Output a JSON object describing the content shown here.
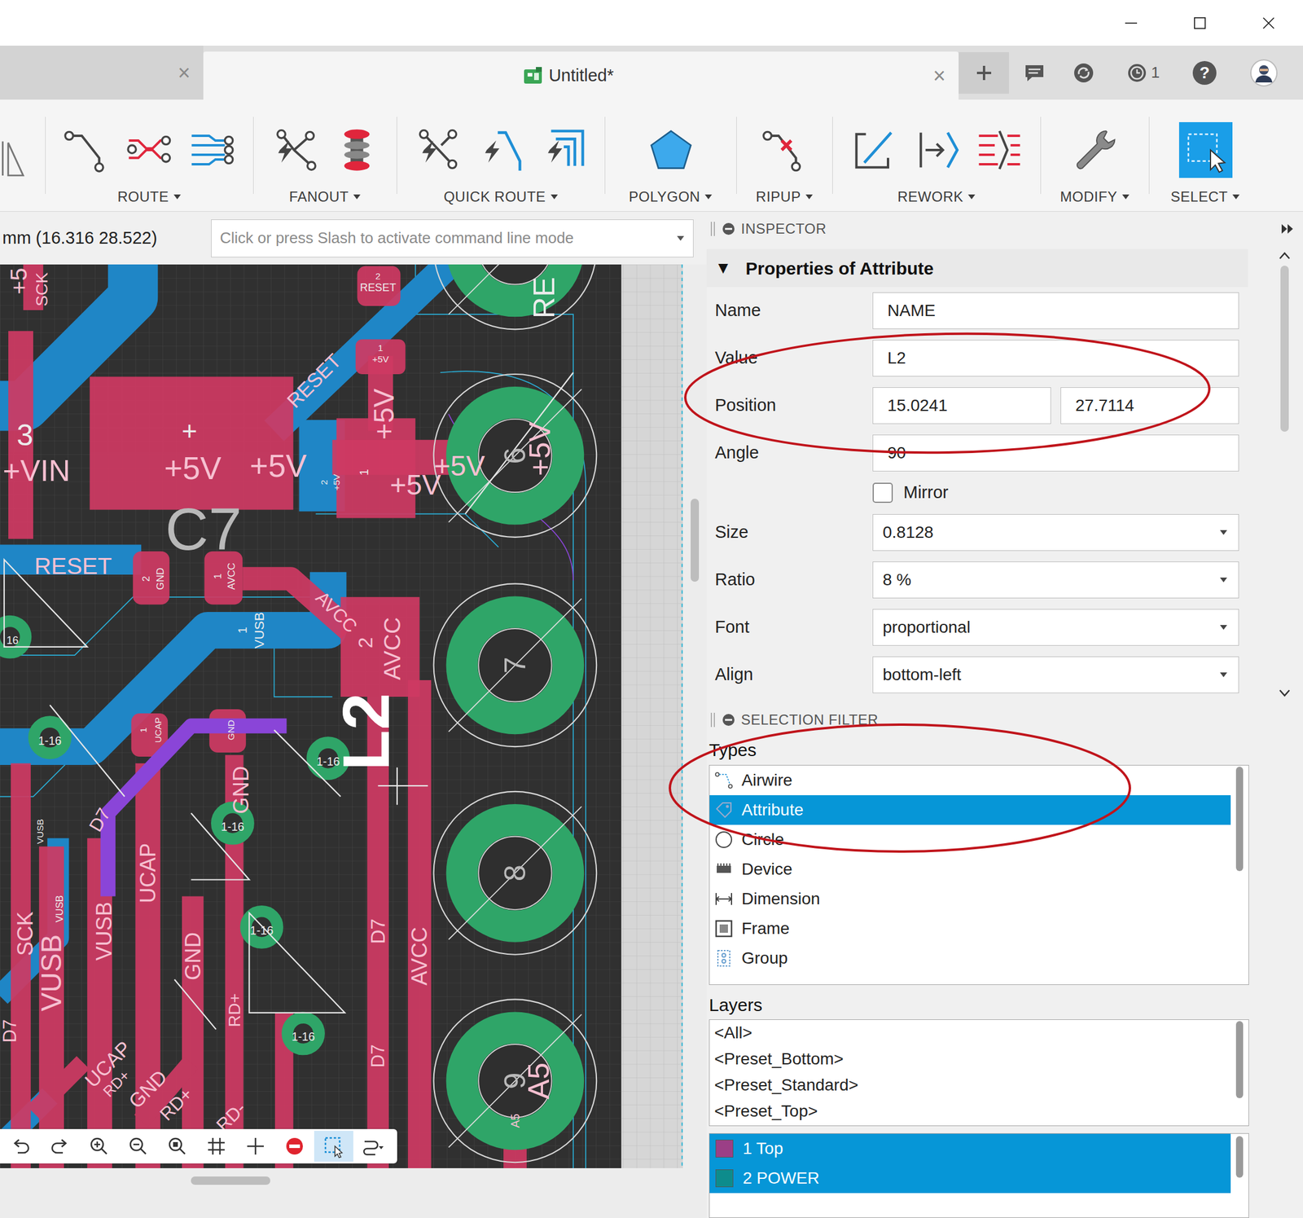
{
  "tabs": [
    {
      "close": "×",
      "selected": false
    },
    {
      "label": "Untitled*",
      "close": "×",
      "selected": true
    }
  ],
  "header": {
    "notifications_count": "1",
    "help": "?"
  },
  "toolbar": {
    "groups": [
      {
        "label": "ROUTE",
        "active": false
      },
      {
        "label": "FANOUT",
        "active": false
      },
      {
        "label": "QUICK ROUTE",
        "active": false
      },
      {
        "label": "POLYGON",
        "active": false
      },
      {
        "label": "RIPUP",
        "active": false
      },
      {
        "label": "REWORK",
        "active": false
      },
      {
        "label": "MODIFY",
        "active": false
      },
      {
        "label": "SELECT",
        "active": true
      }
    ]
  },
  "command_line": {
    "coordinates": "mm (16.316 28.522)",
    "placeholder": "Click or press Slash to activate command line mode"
  },
  "canvas": {
    "labels": [
      "2",
      "RESET",
      "+5",
      "SCK",
      "RE",
      "RESET",
      "1",
      "+5V",
      "3",
      "+VIN",
      "+",
      "+5V",
      "+5V",
      "C7",
      "2",
      "+5V",
      "1",
      "+5V",
      "+5V",
      "+5V",
      "6",
      "+5V",
      "RESET",
      "2",
      "GND",
      "1",
      "AVCC",
      "AVCC",
      "2",
      "AVCC",
      "1",
      "VUSB",
      "16",
      "7",
      "L2",
      "1-16",
      "1-16",
      "1-16",
      "1-16",
      "1-16",
      "1",
      "UCAP",
      "GND",
      "GND",
      "D7",
      "VUSB",
      "UCAP",
      "8",
      "VUSB",
      "SCK",
      "VUSB",
      "VUSB",
      "GND",
      "D7",
      "AVCC",
      "RD+",
      "D7",
      "D7",
      "UCAP",
      "RD+",
      "GND",
      "RD+",
      "RD-",
      "9",
      "A5",
      "A5"
    ]
  },
  "bottom_toolbar": {
    "tools": [
      {
        "active": false
      },
      {
        "active": false
      },
      {
        "active": false
      },
      {
        "active": false
      },
      {
        "active": false
      },
      {
        "active": false
      },
      {
        "active": false
      },
      {
        "active": false
      },
      {
        "active": true
      },
      {
        "active": false
      }
    ]
  },
  "inspector": {
    "title": "INSPECTOR",
    "section": {
      "toggle": "▼",
      "title": "Properties of Attribute",
      "expanded": true
    },
    "fields": [
      {
        "label": "Name",
        "kind": "text",
        "value": "NAME"
      },
      {
        "label": "Value",
        "kind": "text",
        "value": "L2"
      },
      {
        "label": "Position",
        "kind": "pair",
        "values": [
          "15.0241",
          "27.7114"
        ]
      },
      {
        "label": "Angle",
        "kind": "text",
        "value": "90"
      },
      {
        "label": "Mirror",
        "kind": "checkbox",
        "checked": false
      },
      {
        "label": "Size",
        "kind": "select",
        "value": "0.8128"
      },
      {
        "label": "Ratio",
        "kind": "select",
        "value": "8 %"
      },
      {
        "label": "Font",
        "kind": "select",
        "value": "proportional"
      },
      {
        "label": "Align",
        "kind": "select",
        "value": "bottom-left"
      }
    ]
  },
  "selection_filter": {
    "title": "SELECTION FILTER",
    "types_label": "Types",
    "types": [
      {
        "label": "Airwire",
        "selected": false
      },
      {
        "label": "Attribute",
        "selected": true
      },
      {
        "label": "Circle",
        "selected": false
      },
      {
        "label": "Device",
        "selected": false
      },
      {
        "label": "Dimension",
        "selected": false
      },
      {
        "label": "Frame",
        "selected": false
      },
      {
        "label": "Group",
        "selected": false
      }
    ],
    "layers_label": "Layers",
    "layer_presets": [
      {
        "label": "<All>",
        "selected": false
      },
      {
        "label": "<Preset_Bottom>",
        "selected": false
      },
      {
        "label": "<Preset_Standard>",
        "selected": false
      },
      {
        "label": "<Preset_Top>",
        "selected": false
      }
    ],
    "layers": [
      {
        "label": "1 Top",
        "selected": true,
        "color": "#9b3f86"
      },
      {
        "label": "2 POWER",
        "selected": true,
        "color": "#0d8c8c"
      }
    ]
  }
}
